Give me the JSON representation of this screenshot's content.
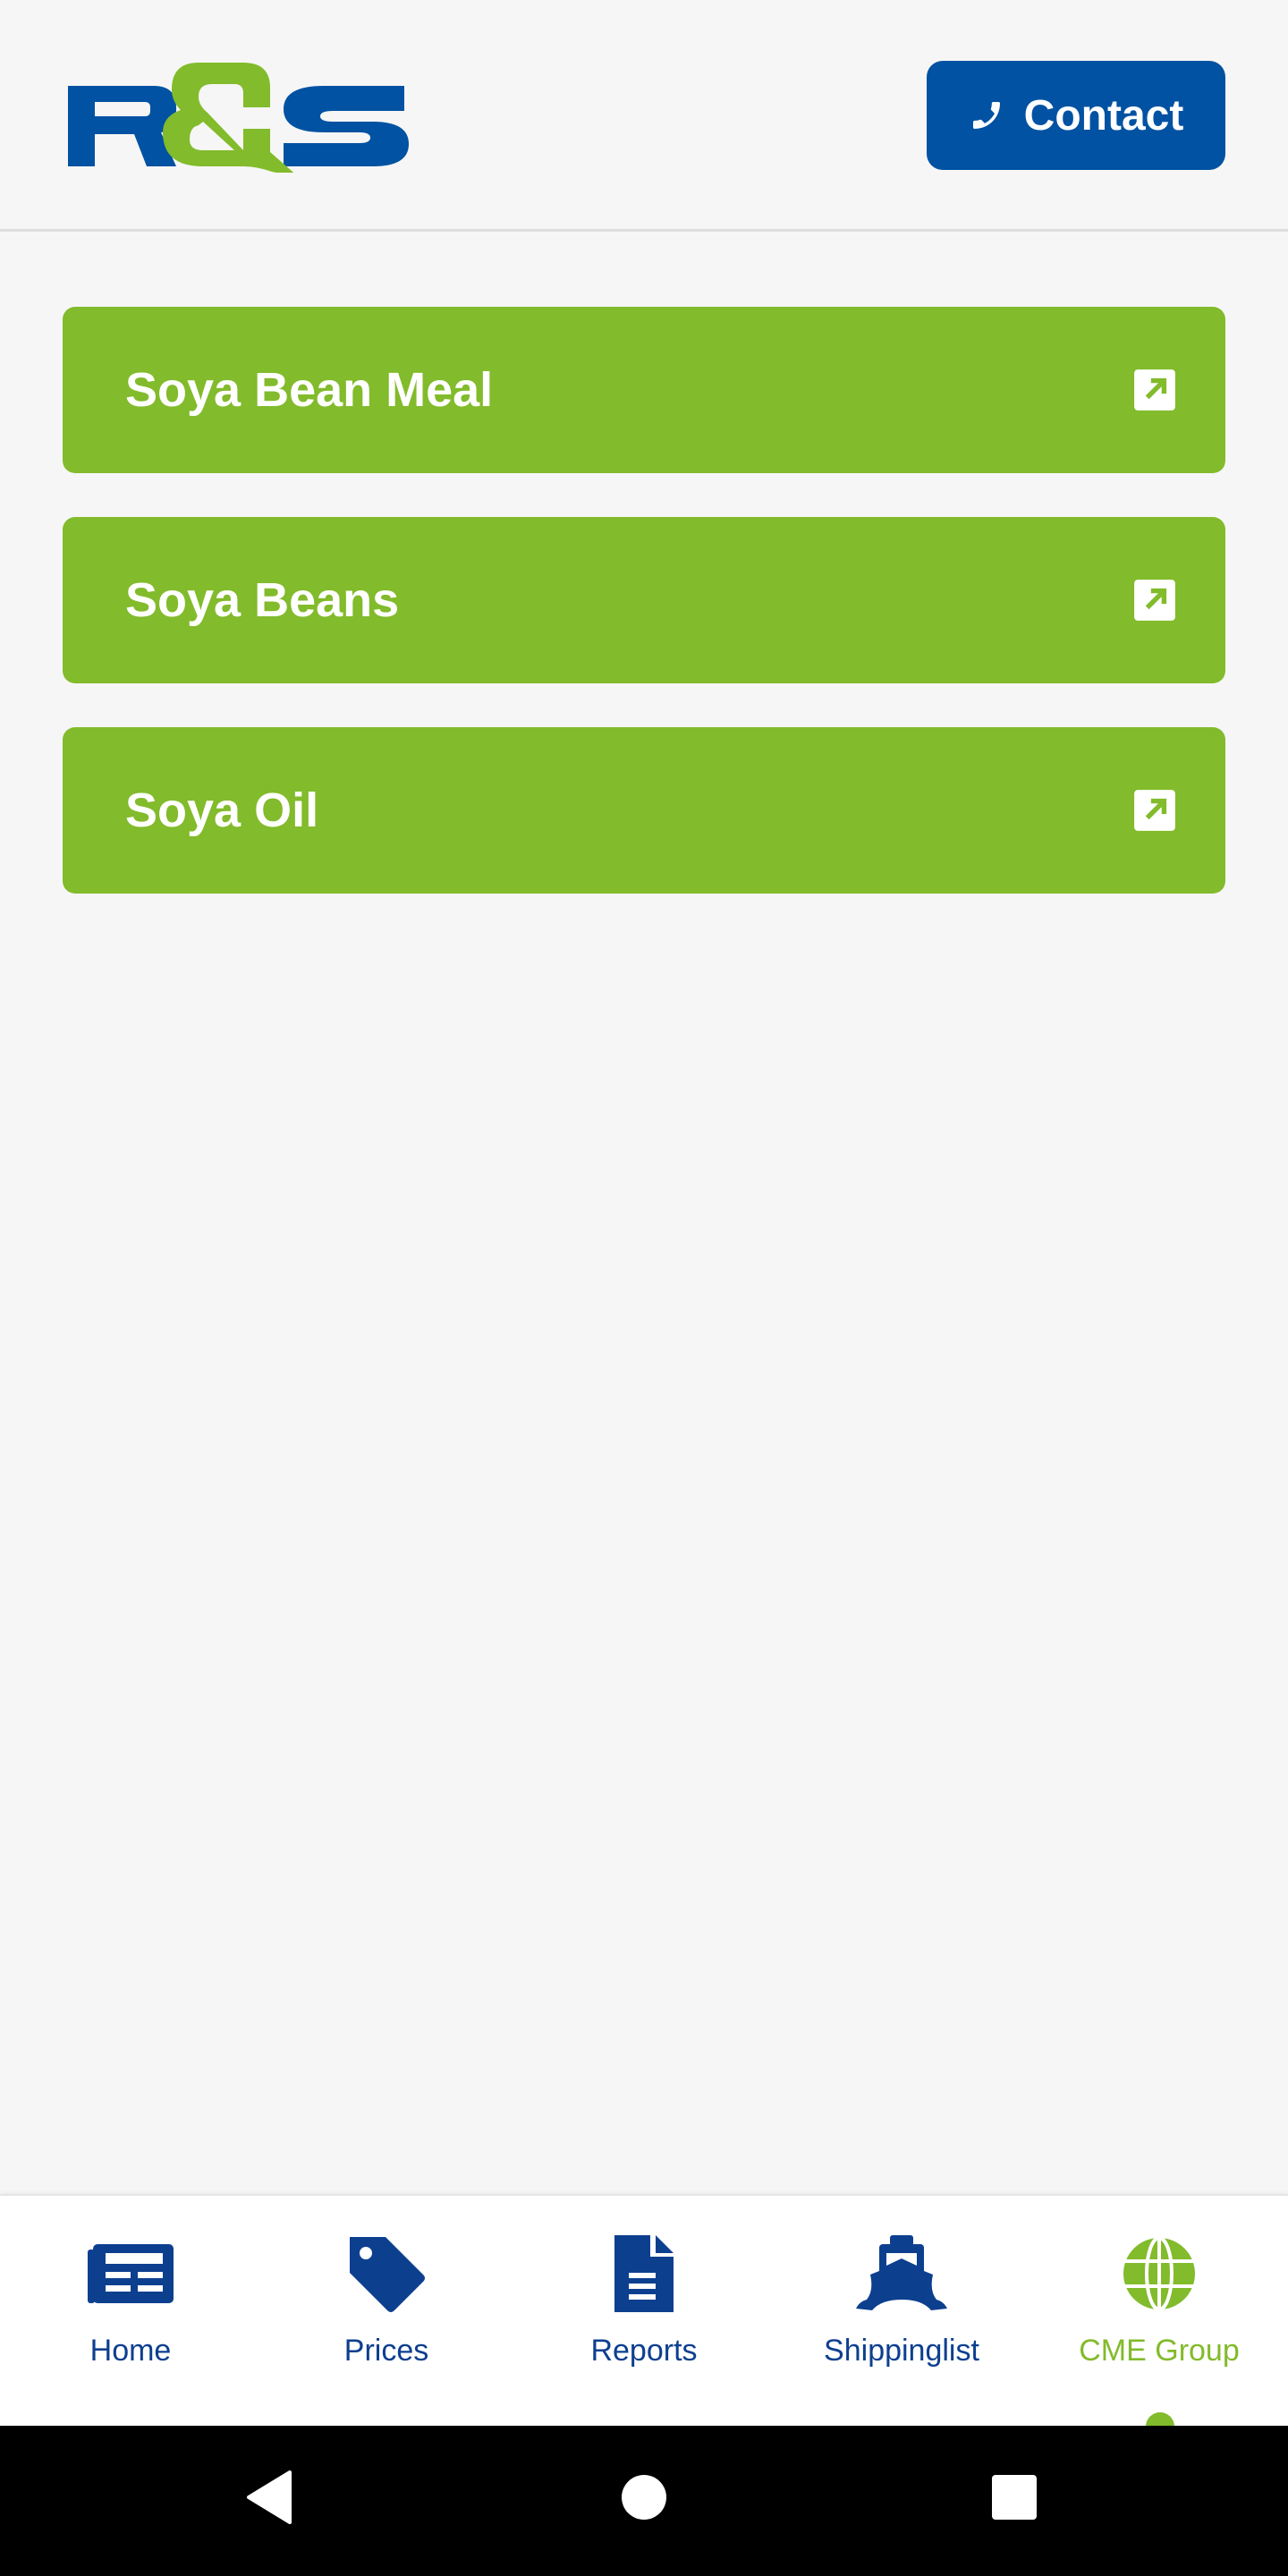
{
  "header": {
    "logo_text": "R&S",
    "contact_label": "Contact",
    "contact_icon": "phone-icon"
  },
  "colors": {
    "primary_blue": "#0152a2",
    "green": "#82bb2b",
    "nav_blue": "#0d3f8f"
  },
  "items": [
    {
      "label": "Soya Bean Meal",
      "icon": "external-link-icon"
    },
    {
      "label": "Soya Beans",
      "icon": "external-link-icon"
    },
    {
      "label": "Soya Oil",
      "icon": "external-link-icon"
    }
  ],
  "bottom_nav": {
    "active": "CME Group",
    "tabs": [
      {
        "label": "Home",
        "icon": "newspaper-icon"
      },
      {
        "label": "Prices",
        "icon": "tag-icon"
      },
      {
        "label": "Reports",
        "icon": "document-icon"
      },
      {
        "label": "Shippinglist",
        "icon": "ship-icon"
      },
      {
        "label": "CME Group",
        "icon": "globe-icon"
      }
    ]
  },
  "system_nav": [
    "back",
    "home",
    "recents"
  ]
}
